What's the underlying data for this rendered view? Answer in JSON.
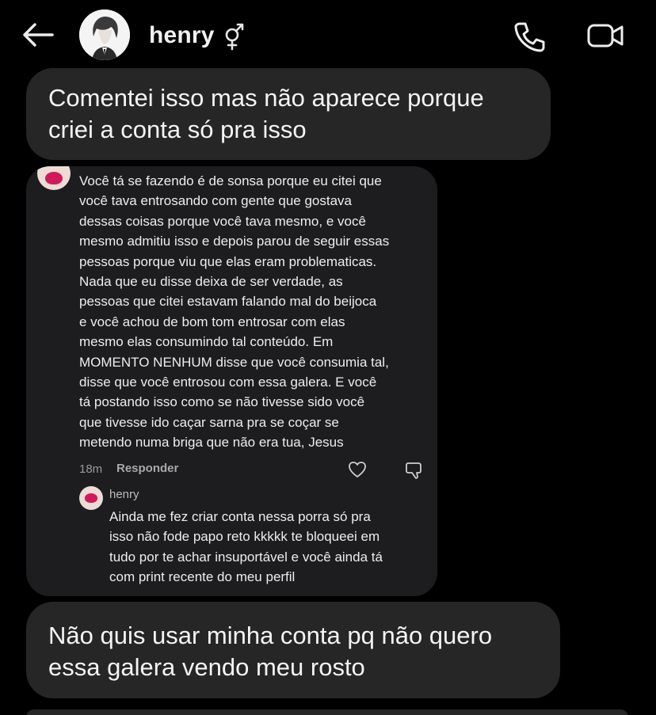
{
  "header": {
    "contact_name": "henry",
    "gender_symbol": "⚧"
  },
  "messages": [
    {
      "text": "Comentei isso mas não aparece porque\ncriei a conta só pra isso"
    },
    {
      "text": "Não quis usar minha conta pq não quero\nessa galera vendo meu rosto"
    }
  ],
  "shared_screenshot": {
    "comment_text": "Você tá se fazendo é de sonsa porque eu citei que\nvocê tava entrosando com gente que gostava\ndessas coisas porque você tava mesmo, e você\nmesmo admitiu isso e depois parou de seguir essas\npessoas porque viu que elas eram problematicas.\nNada que eu disse deixa de ser verdade, as\npessoas que citei estavam falando mal do beijoca\ne você achou de bom tom entrosar com elas\nmesmo elas consumindo tal conteúdo. Em\nMOMENTO NENHUM disse que você consumia tal,\ndisse que você entrosou com essa galera. E você\ntá postando isso como se não tivesse sido você\nque tivesse ido caçar sarna pra se coçar se\nmetendo numa briga que não era tua, Jesus",
    "comment_time": "18m",
    "reply_label": "Responder",
    "reply_username": "henry",
    "reply_text": "Ainda me fez criar conta nessa porra só pra\nisso não fode papo reto kkkkk te bloqueei em\ntudo por te achar insuportável e você ainda tá\ncom print recente do meu perfil"
  },
  "colors": {
    "background": "#000000",
    "bubble": "#262626",
    "shared_bg": "#1d1d1f",
    "text": "#f4f4f4",
    "muted": "#9a9a9a",
    "rose_accent": "#d2195a"
  },
  "icons": [
    "back-arrow-icon",
    "phone-icon",
    "video-camera-icon",
    "heart-icon",
    "dislike-icon",
    "gender-icon"
  ]
}
